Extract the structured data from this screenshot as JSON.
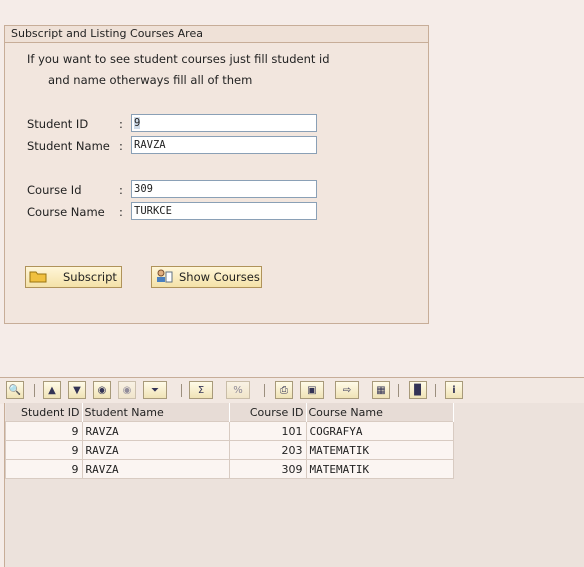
{
  "form": {
    "title": "Subscript and Listing Courses Area",
    "info_line1": "If you want to see student courses just fill student id",
    "info_line2": "and name otherways fill all of them",
    "fields": {
      "student_id": {
        "label": "Student ID",
        "value": "9"
      },
      "student_name": {
        "label": "Student Name",
        "value": "RAVZA"
      },
      "course_id": {
        "label": "Course Id",
        "value": "309"
      },
      "course_name": {
        "label": "Course Name",
        "value": "TURKCE"
      }
    },
    "colon": ":",
    "buttons": {
      "subscript": "Subscript",
      "show_courses": "Show Courses"
    }
  },
  "grid": {
    "headers": [
      "Student ID",
      "Student Name",
      "Course ID",
      "Course Name"
    ],
    "rows": [
      [
        "9",
        "RAVZA",
        "101",
        "COGRAFYA"
      ],
      [
        "9",
        "RAVZA",
        "203",
        "MATEMATIK"
      ],
      [
        "9",
        "RAVZA",
        "309",
        "MATEMATIK"
      ]
    ]
  },
  "toolbar_icons": [
    "details-icon",
    "sort-ascending-icon",
    "sort-descending-icon",
    "find-icon",
    "find-next-icon",
    "filter-icon",
    "sum-icon",
    "subtotals-icon",
    "print-icon",
    "views-icon",
    "export-icon",
    "layout-icon",
    "graphic-icon",
    "info-icon"
  ],
  "colors": {
    "background": "#f5ece8",
    "border": "#c7ad98",
    "button": "#f4e2a8"
  }
}
